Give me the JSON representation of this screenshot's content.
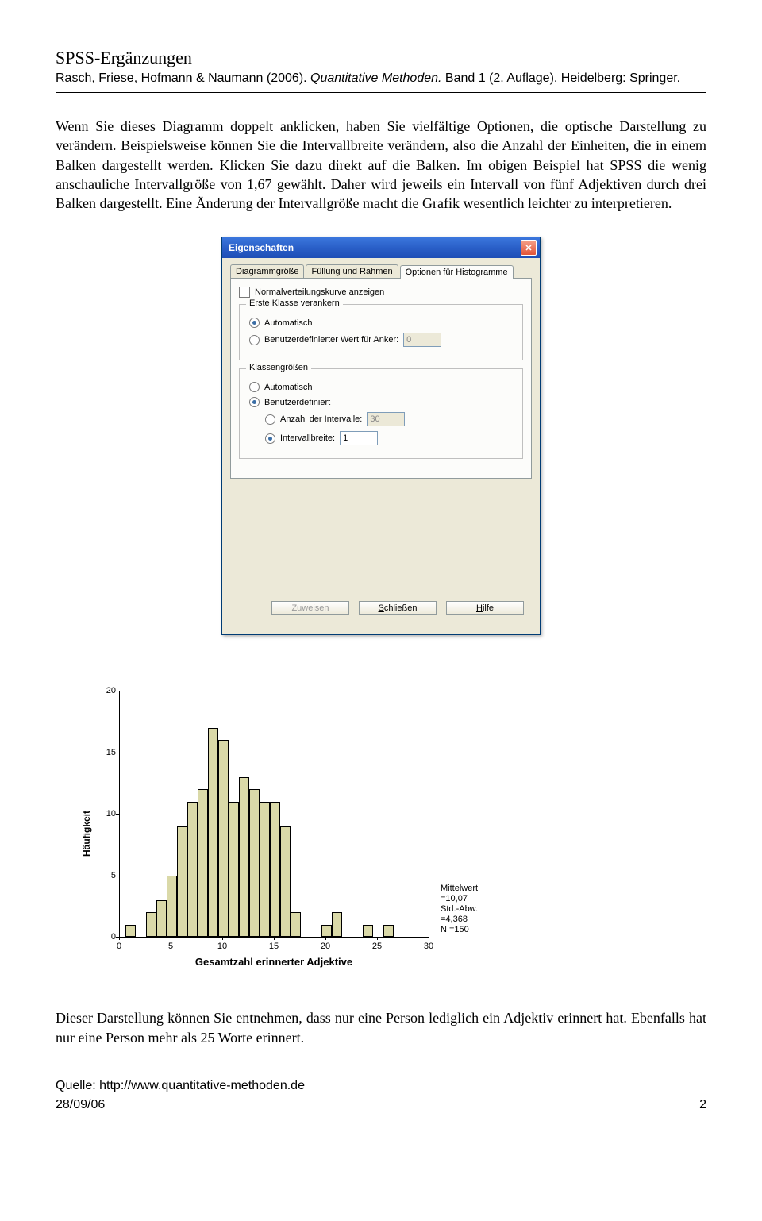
{
  "header": {
    "title": "SPSS-Ergänzungen",
    "authors": "Rasch, Friese, Hofmann & Naumann (2006). ",
    "book": "Quantitative Methoden. ",
    "rest": "Band 1 (2. Auflage). Heidelberg: Springer."
  },
  "para1": "Wenn Sie dieses Diagramm doppelt anklicken, haben Sie vielfältige Optionen, die optische Darstellung zu verändern. Beispielsweise können Sie die Intervallbreite verändern, also die Anzahl der Einheiten, die in einem Balken dargestellt werden. Klicken Sie dazu direkt auf die Balken. Im obigen Beispiel hat SPSS die wenig anschauliche Intervallgröße von 1,67 gewählt. Daher wird jeweils ein Intervall von fünf Adjektiven durch drei Balken dargestellt. Eine Änderung der Intervallgröße macht die Grafik wesentlich leichter zu interpretieren.",
  "dialog": {
    "title": "Eigenschaften",
    "tabs": [
      "Diagrammgröße",
      "Füllung und Rahmen",
      "Optionen für Histogramme"
    ],
    "active_tab": 2,
    "checkbox": "Normalverteilungskurve anzeigen",
    "group1": {
      "legend": "Erste Klasse verankern",
      "opt1": "Automatisch",
      "opt2": "Benutzerdefinierter Wert für Anker:",
      "val": "0",
      "selected": 0
    },
    "group2": {
      "legend": "Klassengrößen",
      "opt1": "Automatisch",
      "opt2": "Benutzerdefiniert",
      "sub1": "Anzahl der Intervalle:",
      "sub1_val": "30",
      "sub2": "Intervallbreite:",
      "sub2_val": "1",
      "selected": 1,
      "subselected": 1
    },
    "buttons": {
      "apply": "Zuweisen",
      "close": "Schließen",
      "help": "Hilfe"
    }
  },
  "chart_data": {
    "type": "bar",
    "title": "",
    "xlabel": "Gesamtzahl erinnerter Adjektive",
    "ylabel": "Häufigkeit",
    "xlim": [
      0,
      30
    ],
    "ylim": [
      0,
      20
    ],
    "xticks": [
      0,
      5,
      10,
      15,
      20,
      25,
      30
    ],
    "yticks": [
      0,
      5,
      10,
      15,
      20
    ],
    "bin_width": 1,
    "categories": [
      1,
      2,
      3,
      4,
      5,
      6,
      7,
      8,
      9,
      10,
      11,
      12,
      13,
      14,
      15,
      16,
      17,
      18,
      19,
      20,
      21,
      22,
      23,
      24,
      25,
      26
    ],
    "values": [
      1,
      0,
      2,
      3,
      5,
      9,
      11,
      12,
      17,
      16,
      11,
      13,
      12,
      11,
      11,
      9,
      2,
      0,
      0,
      1,
      2,
      0,
      0,
      1,
      0,
      1
    ],
    "annotations": {
      "mean": "Mittelwert =10,07",
      "sd": "Std.-Abw. =4,368",
      "n": "N =150"
    }
  },
  "para2": "Dieser Darstellung können Sie entnehmen, dass nur eine Person lediglich ein Adjektiv erinnert hat. Ebenfalls hat nur eine Person mehr als 25 Worte erinnert.",
  "footer": {
    "source": "Quelle: http://www.quantitative-methoden.de",
    "date": "28/09/06",
    "page": "2"
  }
}
